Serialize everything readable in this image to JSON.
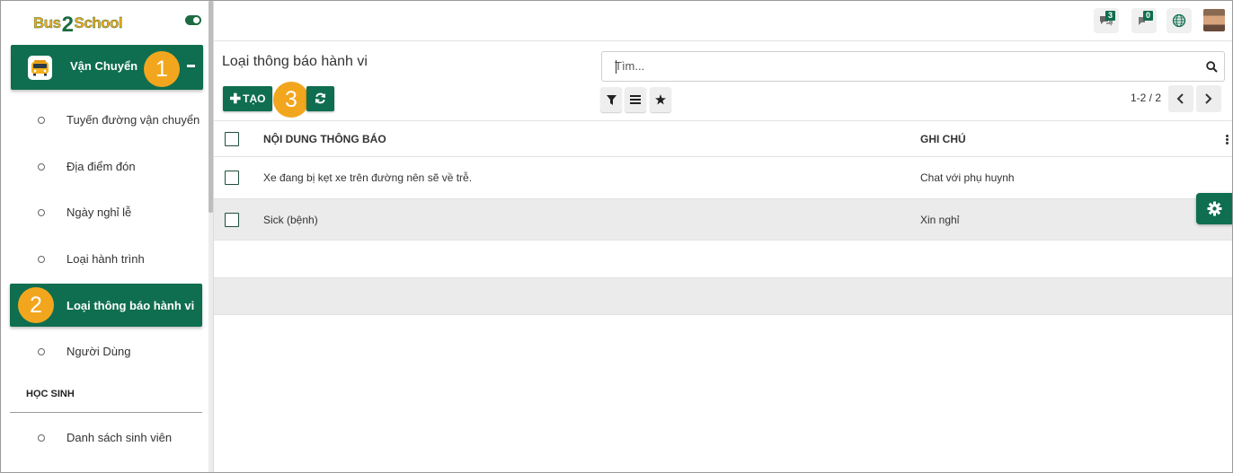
{
  "app": {
    "logo_part1": "Bus",
    "logo_part2": "2",
    "logo_part3": "School"
  },
  "sidebar": {
    "main_menu": {
      "label": "Vận Chuyển",
      "step_badge": "1"
    },
    "items": [
      {
        "label": "Tuyến đường vận chuyển"
      },
      {
        "label": "Địa điểm đón"
      },
      {
        "label": "Ngày nghỉ lễ"
      },
      {
        "label": "Loại hành trình"
      },
      {
        "label": "Loại thông báo hành vi",
        "active": true,
        "step_badge": "2"
      },
      {
        "label": "Người Dùng"
      }
    ],
    "section_label": "HỌC SINH",
    "section_items": [
      {
        "label": "Danh sách sinh viên"
      }
    ]
  },
  "topbar": {
    "messages_count": "3",
    "activities_count": "0",
    "icons": [
      "chat-icon",
      "activity-icon",
      "globe-icon",
      "avatar"
    ]
  },
  "control_panel": {
    "title": "Loại thông báo hành vi",
    "search_placeholder": "Tìm...",
    "create_label": "TẠO",
    "create_step_badge": "3",
    "pager": "1-2 / 2"
  },
  "table": {
    "columns": [
      "NỘI DUNG THÔNG BÁO",
      "GHI CHÚ"
    ],
    "rows": [
      {
        "content": "Xe đang bị kẹt xe trên đường nên sẽ về trễ.",
        "note": "Chat với phụ huynh"
      },
      {
        "content": "Sick (bệnh)",
        "note": "Xin nghỉ"
      }
    ]
  },
  "colors": {
    "primary": "#0f6e4f",
    "badge": "#f2a61e",
    "row_highlight": "#ebebeb"
  }
}
